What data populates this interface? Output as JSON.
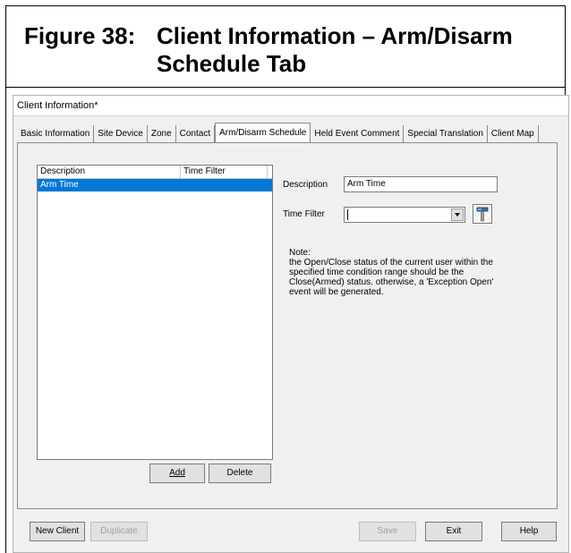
{
  "caption": {
    "number": "Figure 38:",
    "title_line1": "Client Information – Arm/Disarm",
    "title_line2": "Schedule Tab"
  },
  "window": {
    "title": "Client Information*"
  },
  "tabs": [
    {
      "label": "Basic Information",
      "active": false
    },
    {
      "label": "Site Device",
      "active": false
    },
    {
      "label": "Zone",
      "active": false
    },
    {
      "label": "Contact",
      "active": false
    },
    {
      "label": "Arm/Disarm Schedule",
      "active": true
    },
    {
      "label": "Held Event Comment",
      "active": false
    },
    {
      "label": "Special Translation",
      "active": false
    },
    {
      "label": "Client Map",
      "active": false
    }
  ],
  "list": {
    "columns": [
      "Description",
      "Time Filter"
    ],
    "rows": [
      {
        "description": "Arm Time",
        "time_filter": "",
        "selected": true
      }
    ]
  },
  "list_buttons": {
    "add": "Add",
    "delete": "Delete"
  },
  "form": {
    "description_label": "Description",
    "description_value": "Arm Time",
    "time_filter_label": "Time Filter",
    "time_filter_value": ""
  },
  "note": {
    "heading": "Note:",
    "lines": [
      "the Open/Close status of the current user within the",
      "specified time condition range should be the",
      "Close(Armed) status. otherwise, a 'Exception Open'",
      "event will be generated."
    ]
  },
  "footer_buttons": {
    "new_client": "New Client",
    "duplicate": "Duplicate",
    "save": "Save",
    "exit": "Exit",
    "help": "Help"
  },
  "icons": {
    "tool": "hammer-tool-icon",
    "dropdown": "chevron-down-icon"
  }
}
